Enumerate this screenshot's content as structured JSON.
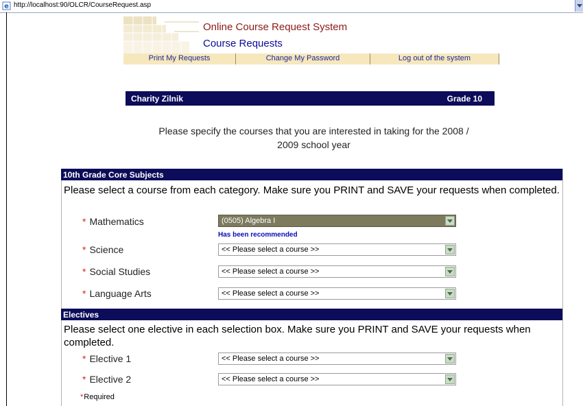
{
  "browser": {
    "url": "http://localhost:90/OLCR/CourseRequest.asp"
  },
  "header": {
    "site_title": "Online Course Request System",
    "page_subtitle": "Course Requests"
  },
  "nav": {
    "print_label": "Print My Requests",
    "password_label": "Change My Password",
    "logout_label": "Log out of the system"
  },
  "student": {
    "name": "Charity Zilnik",
    "grade": "Grade 10"
  },
  "intro": {
    "line1": "Please specify the courses that you are interested in taking for the 2008 /",
    "line2": "2009 school year"
  },
  "core": {
    "heading": "10th Grade Core Subjects",
    "instruction": "Please select a course from each category. Make sure you PRINT and SAVE your requests when completed.",
    "fields": [
      {
        "label": "Mathematics",
        "value": "(0505) Algebra I",
        "note": "Has been recommended"
      },
      {
        "label": "Science",
        "value": "<< Please select a course >>"
      },
      {
        "label": "Social Studies",
        "value": "<< Please select a course >>"
      },
      {
        "label": "Language Arts",
        "value": "<< Please select a course >>"
      }
    ]
  },
  "electives": {
    "heading": "Electives",
    "instruction": "Please select one elective in each selection box. Make sure you PRINT and SAVE your requests when completed.",
    "fields": [
      {
        "label": "Elective 1",
        "value": "<< Please select a course >>"
      },
      {
        "label": "Elective 2",
        "value": "<< Please select a course >>"
      }
    ]
  },
  "required_marker": "*",
  "required_note": "Required",
  "colors": {
    "accent_navy": "#0c0c5a",
    "title_red": "#8b1a1a",
    "nav_bg": "#f6e7bd",
    "required_red": "#e02020"
  },
  "icons": {
    "address_icon": "ie-page-icon",
    "dropdown_icon": "chevron-down-icon"
  }
}
